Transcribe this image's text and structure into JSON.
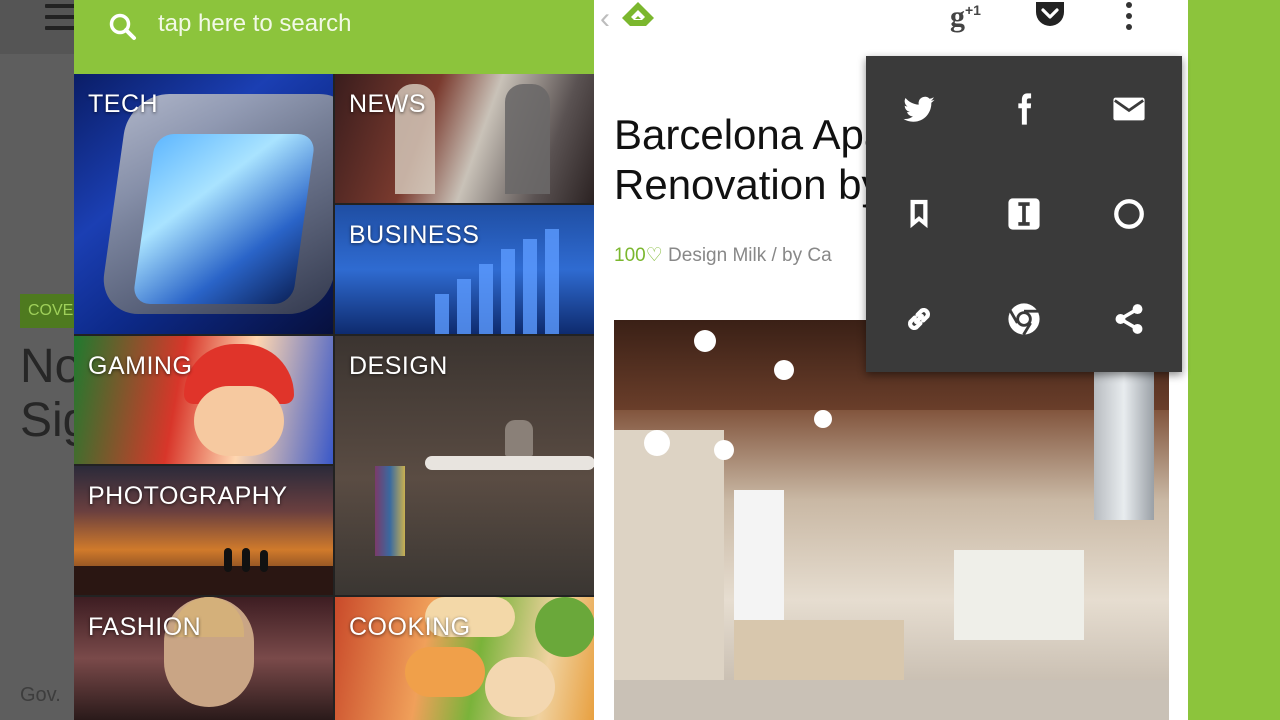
{
  "background_app": {
    "badge": "COVER",
    "headline_lines": [
      "No",
      "Sig"
    ],
    "footer": "Gov."
  },
  "search": {
    "placeholder": "tap here to search",
    "icon": "search-icon"
  },
  "categories": [
    {
      "label": "TECH"
    },
    {
      "label": "NEWS"
    },
    {
      "label": "BUSINESS"
    },
    {
      "label": "GAMING"
    },
    {
      "label": "DESIGN"
    },
    {
      "label": "PHOTOGRAPHY"
    },
    {
      "label": "FASHION"
    },
    {
      "label": "COOKING"
    }
  ],
  "article": {
    "title_lines": [
      "Barcelona Apa",
      "Renovation by"
    ],
    "saves": "100",
    "source_text": "Design Milk / by Ca"
  },
  "toolbar": {
    "back_icon": "chevron-left-icon",
    "logo_icon": "feedly-logo-icon",
    "gplus_label": "g",
    "gplus_plus": "+1",
    "pocket_icon": "pocket-icon",
    "overflow_icon": "overflow-menu-icon"
  },
  "share_menu": {
    "items": [
      "twitter-icon",
      "facebook-icon",
      "email-icon",
      "bookmark-icon",
      "instapaper-icon",
      "circle-icon",
      "link-icon",
      "chrome-icon",
      "share-icon"
    ]
  },
  "colors": {
    "accent": "#8cc43c",
    "popup": "#3a3a3a"
  }
}
